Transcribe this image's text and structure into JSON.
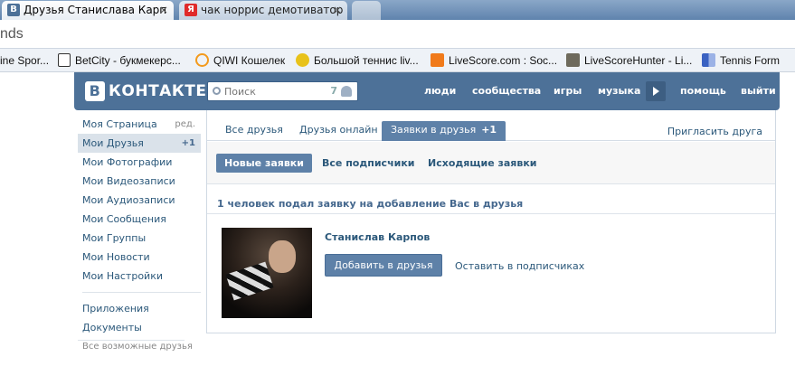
{
  "browser": {
    "tabs": [
      {
        "title": "Друзья Станислава Карп",
        "favicon": "B",
        "favicon_color": "#4d7198"
      },
      {
        "title": "чак норрис демотиватор",
        "favicon": "Я",
        "favicon_color": "#e02a2a"
      }
    ],
    "address": "nds",
    "bookmarks": [
      {
        "label": "ine Spor..."
      },
      {
        "label": "BetCity - букмекерс..."
      },
      {
        "label": "QIWI Кошелек"
      },
      {
        "label": "Большой теннис liv..."
      },
      {
        "label": "LiveScore.com : Soc..."
      },
      {
        "label": "LiveScoreHunter - Li..."
      },
      {
        "label": "Tennis Form"
      }
    ]
  },
  "vk": {
    "logo_letter": "В",
    "logo_text": "КОНТАКТЕ",
    "search": {
      "placeholder": "Поиск",
      "count": "7"
    },
    "nav": [
      "люди",
      "сообщества",
      "игры",
      "музыка",
      "помощь",
      "выйти"
    ],
    "colors": {
      "header": "#4d7198",
      "accent": "#5e81a8",
      "link": "#2b587a"
    }
  },
  "sidebar": {
    "items": [
      {
        "label": "Моя Страница",
        "right": "ред."
      },
      {
        "label": "Мои Друзья",
        "right": "+1"
      },
      {
        "label": "Мои Фотографии"
      },
      {
        "label": "Мои Видеозаписи"
      },
      {
        "label": "Мои Аудиозаписи"
      },
      {
        "label": "Мои Сообщения"
      },
      {
        "label": "Мои Группы"
      },
      {
        "label": "Мои Новости"
      },
      {
        "label": "Мои Настройки"
      }
    ],
    "extra": [
      "Приложения",
      "Документы"
    ],
    "footer": "Все возможные друзья"
  },
  "content": {
    "tabs": [
      "Все друзья",
      "Друзья онлайн",
      "Заявки в друзья"
    ],
    "tab_badge": "+1",
    "invite": "Пригласить друга",
    "subtabs": [
      "Новые заявки",
      "Все подписчики",
      "Исходящие заявки"
    ],
    "header": "1 человек подал заявку на добавление Вас в друзья",
    "request": {
      "name": "Станислав Карпов",
      "add_button": "Добавить в друзья",
      "keep_link": "Оставить в подписчиках"
    }
  }
}
